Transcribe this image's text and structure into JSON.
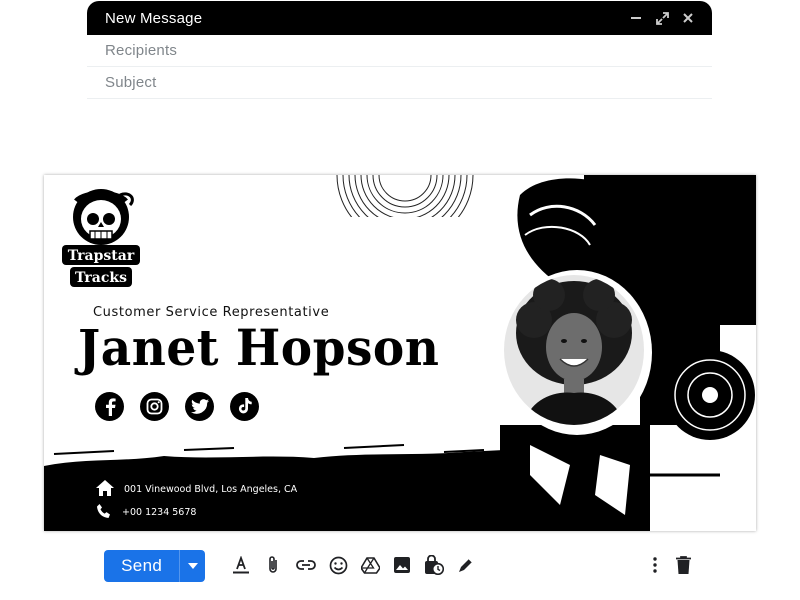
{
  "compose": {
    "title": "New Message",
    "recipients_placeholder": "Recipients",
    "subject_placeholder": "Subject",
    "header_icons": [
      "minimize-icon",
      "fullscreen-icon",
      "close-icon"
    ]
  },
  "signature": {
    "logo_text_line1": "Trapstar",
    "logo_text_line2": "Tracks",
    "job_title": "Customer Service Representative",
    "name": "Janet Hopson",
    "socials": [
      "facebook-icon",
      "instagram-icon",
      "twitter-icon",
      "tiktok-icon"
    ],
    "address": "001 Vinewood Blvd, Los Angeles, CA",
    "phone": "+00 1234 5678"
  },
  "toolbar": {
    "send_label": "Send",
    "icons": [
      "format-text-icon",
      "attach-icon",
      "link-icon",
      "emoji-icon",
      "drive-icon",
      "image-icon",
      "confidential-icon",
      "signature-pen-icon",
      "more-options-icon",
      "trash-icon"
    ]
  },
  "colors": {
    "accent": "#1a73e8",
    "header": "#000000",
    "placeholder": "#80868b"
  }
}
